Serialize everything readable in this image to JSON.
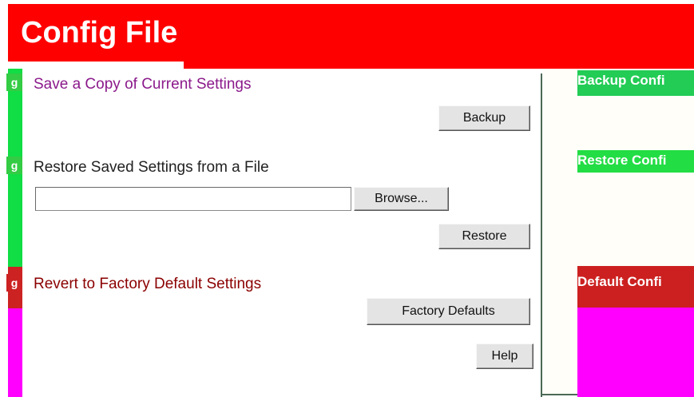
{
  "header": {
    "title": "Config File"
  },
  "sections": {
    "save": {
      "label": "Save a Copy of Current Settings",
      "button": "Backup",
      "color": "#8b1a8b"
    },
    "restore": {
      "label": "Restore Saved Settings from a File",
      "browse_button": "Browse...",
      "button": "Restore",
      "file_value": "",
      "color": "#222222"
    },
    "revert": {
      "label": "Revert to Factory Default Settings",
      "button": "Factory Defaults",
      "color": "#8b0000"
    }
  },
  "help_button": "Help",
  "side_headings": {
    "backup": "Backup Confi",
    "restore": "Restore Confi",
    "default": "Default Confi"
  },
  "bullets": {
    "one": "g",
    "two": "g",
    "three": "g"
  },
  "colors": {
    "header": "#ff0000",
    "green": "#22dd44",
    "magenta": "#ff00ff"
  }
}
